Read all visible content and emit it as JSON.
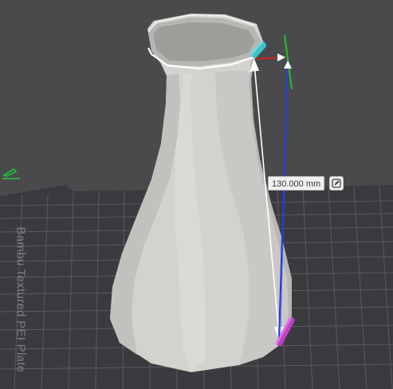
{
  "measurement": {
    "distance_label": "130.000 mm"
  },
  "build_plate": {
    "label": "Bambu Textured PEI Plate"
  },
  "icons": {
    "edit": "edit-pencil-icon",
    "plate_marker": "plate-edit-icon"
  },
  "colors": {
    "background": "#4a4a4d",
    "plate": "#3b3b3f",
    "grid": "#5a5a5f",
    "model": "#d8d7d3",
    "measure_line": "#1f3bd6",
    "dimension_arrow": "#ffffff",
    "axis_y": "#22c02a",
    "axis_x": "#d02020",
    "gizmo_start": "#3cc3c8",
    "gizmo_end": "#c040c8"
  }
}
